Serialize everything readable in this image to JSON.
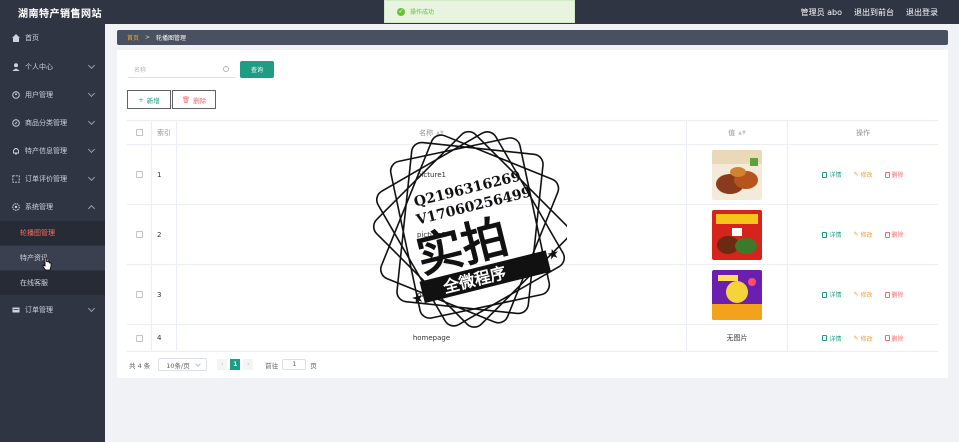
{
  "header": {
    "brand": "湖南特产销售网站",
    "user_label": "管理员 abo",
    "front_link": "退出到前台",
    "logout_link": "退出登录"
  },
  "toast": {
    "message": "操作成功"
  },
  "sidebar": {
    "items": [
      {
        "label": "首页"
      },
      {
        "label": "个人中心"
      },
      {
        "label": "用户管理"
      },
      {
        "label": "商品分类管理"
      },
      {
        "label": "特产信息管理"
      },
      {
        "label": "订单评价管理"
      },
      {
        "label": "系统管理"
      },
      {
        "label": "订单管理"
      }
    ],
    "sub_items": [
      {
        "label": "轮播图管理"
      },
      {
        "label": "特产资讯"
      },
      {
        "label": "在线客服"
      }
    ]
  },
  "breadcrumb": {
    "home": "首页",
    "current": "轮播图管理"
  },
  "search": {
    "placeholder": "名称",
    "button": "查询"
  },
  "actions": {
    "add": "新增",
    "delete": "删除"
  },
  "table": {
    "headers": {
      "index": "索引",
      "name": "名称",
      "value": "值",
      "ops": "操作"
    },
    "rows": [
      {
        "index": "1",
        "name": "picture1",
        "value_text": ""
      },
      {
        "index": "2",
        "name": "picture2",
        "value_text": ""
      },
      {
        "index": "3",
        "name": "picture3",
        "value_text": ""
      },
      {
        "index": "4",
        "name": "homepage",
        "value_text": "无图片"
      }
    ],
    "ops": {
      "detail": "详情",
      "edit": "修改",
      "remove": "删除"
    }
  },
  "pager": {
    "total": "共 4 条",
    "page_size": "10条/页",
    "current_page": "1",
    "goto_label": "前往",
    "goto_value": "1",
    "goto_unit": "页"
  },
  "watermark": {
    "line1": "Q2196316269",
    "line2": "V17060256499",
    "big": "实拍",
    "ribbon": "全微程序"
  },
  "colors": {
    "primary": "#1f9c84",
    "sidebar_bg": "#2f3542",
    "danger": "#f56c6c",
    "warning": "#e6a23c",
    "active_menu": "#ff6f61"
  }
}
